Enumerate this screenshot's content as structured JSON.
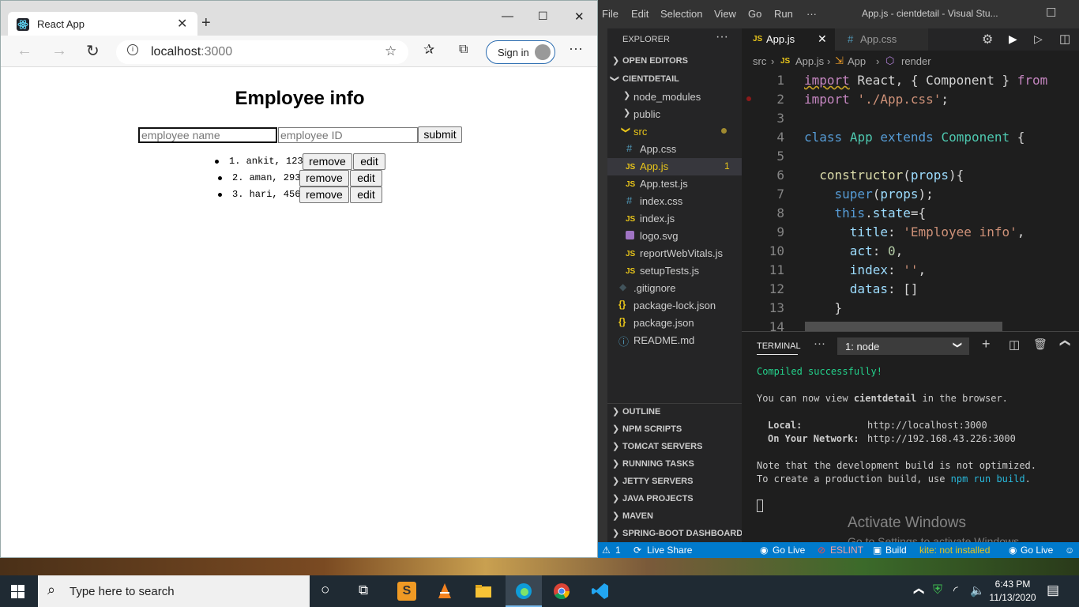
{
  "browser": {
    "tab_title": "React App",
    "url_host": "localhost",
    "url_port": ":3000",
    "signin_label": "Sign in"
  },
  "app": {
    "title": "Employee info",
    "name_placeholder": "employee name",
    "id_placeholder": "employee ID",
    "submit_label": "submit",
    "remove_label": "remove",
    "edit_label": "edit",
    "items": [
      {
        "text": "1. ankit, 123"
      },
      {
        "text": "2. aman, 293"
      },
      {
        "text": "3. hari, 456"
      }
    ]
  },
  "vscode": {
    "menu": [
      "File",
      "Edit",
      "Selection",
      "View",
      "Go",
      "Run",
      "···"
    ],
    "window_title": "App.js - cientdetail - Visual Stu...",
    "explorer_title": "EXPLORER",
    "open_editors": "OPEN EDITORS",
    "project": "CIENTDETAIL",
    "tree": [
      {
        "label": "node_modules",
        "kind": "folder"
      },
      {
        "label": "public",
        "kind": "folder"
      },
      {
        "label": "src",
        "kind": "folder-open"
      },
      {
        "label": "App.css",
        "kind": "css"
      },
      {
        "label": "App.js",
        "kind": "js",
        "badge": "1"
      },
      {
        "label": "App.test.js",
        "kind": "js"
      },
      {
        "label": "index.css",
        "kind": "css"
      },
      {
        "label": "index.js",
        "kind": "js"
      },
      {
        "label": "logo.svg",
        "kind": "svg"
      },
      {
        "label": "reportWebVitals.js",
        "kind": "js"
      },
      {
        "label": "setupTests.js",
        "kind": "js"
      },
      {
        "label": ".gitignore",
        "kind": "git"
      },
      {
        "label": "package-lock.json",
        "kind": "json"
      },
      {
        "label": "package.json",
        "kind": "json"
      },
      {
        "label": "README.md",
        "kind": "info"
      }
    ],
    "sections": [
      "OUTLINE",
      "NPM SCRIPTS",
      "TOMCAT SERVERS",
      "RUNNING TASKS",
      "JETTY SERVERS",
      "JAVA PROJECTS",
      "MAVEN",
      "SPRING-BOOT DASHBOARD"
    ],
    "tabs": [
      "App.js",
      "App.css"
    ],
    "breadcrumb": [
      "src",
      "App.js",
      "App",
      "render"
    ],
    "line_numbers": [
      "1",
      "2",
      "3",
      "4",
      "5",
      "6",
      "7",
      "8",
      "9",
      "10",
      "11",
      "12",
      "13",
      "14"
    ],
    "terminal_tab": "TERMINAL",
    "terminal_select": "1: node",
    "terminal": {
      "compiled": "Compiled successfully!",
      "view_pre": "You can now view ",
      "view_app": "cientdetail",
      "view_post": " in the browser.",
      "local_label": "Local:",
      "local_url": "http://localhost:3000",
      "network_label": "On Your Network:",
      "network_url": "http://192.168.43.226:3000",
      "note1": "Note that the development build is not optimized.",
      "note2_pre": "To create a production build, use ",
      "note2_cmd": "npm run build",
      "note2_post": "."
    },
    "status": {
      "problems": "1",
      "live_share": "Live Share",
      "go_live": "Go Live",
      "eslint": "ESLINT",
      "build": "Build",
      "kite": "kite: not installed",
      "go_live2": "Go Live"
    },
    "activate_title": "Activate Windows",
    "activate_sub": "Go to Settings to activate Windows."
  },
  "taskbar": {
    "search_placeholder": "Type here to search",
    "time": "6:43 PM",
    "date": "11/13/2020"
  }
}
